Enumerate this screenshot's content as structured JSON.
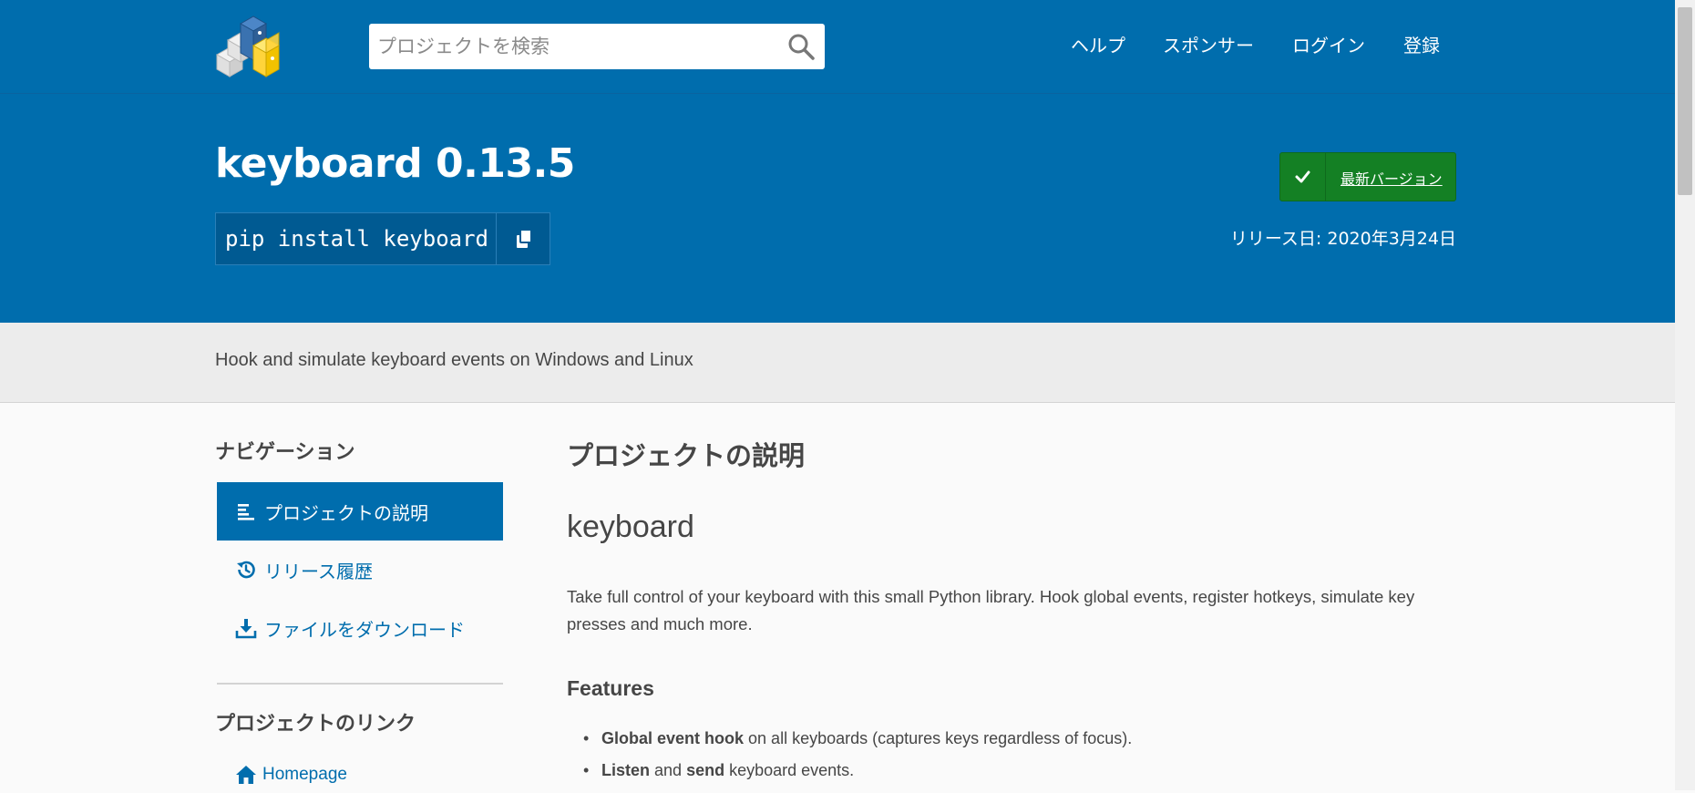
{
  "header": {
    "search_placeholder": "プロジェクトを検索",
    "nav": [
      "ヘルプ",
      "スポンサー",
      "ログイン",
      "登録"
    ]
  },
  "hero": {
    "title": "keyboard 0.13.5",
    "pip_command": "pip install keyboard",
    "latest_label": "最新バージョン",
    "release_date": "リリース日: 2020年3月24日"
  },
  "summary": "Hook and simulate keyboard events on Windows and Linux",
  "sidebar": {
    "nav_heading": "ナビゲーション",
    "items": [
      {
        "label": "プロジェクトの説明",
        "icon": "align-left-icon",
        "active": true
      },
      {
        "label": "リリース履歴",
        "icon": "history-icon",
        "active": false
      },
      {
        "label": "ファイルをダウンロード",
        "icon": "download-icon",
        "active": false
      }
    ],
    "links_heading": "プロジェクトのリンク",
    "homepage_label": "Homepage"
  },
  "main": {
    "section_title": "プロジェクトの説明",
    "heading": "keyboard",
    "paragraph": "Take full control of your keyboard with this small Python library. Hook global events, register hotkeys, simulate key presses and much more.",
    "features_heading": "Features",
    "features": [
      {
        "bold1": "Global event hook",
        "text1": " on all keyboards (captures keys regardless of focus).",
        "bold2": "",
        "text2": ""
      },
      {
        "bold1": "Listen",
        "text1": " and ",
        "bold2": "send",
        "text2": " keyboard events."
      }
    ]
  },
  "colors": {
    "brand_blue": "#006dad",
    "success_green": "#148024",
    "summary_gray": "#ececec"
  }
}
